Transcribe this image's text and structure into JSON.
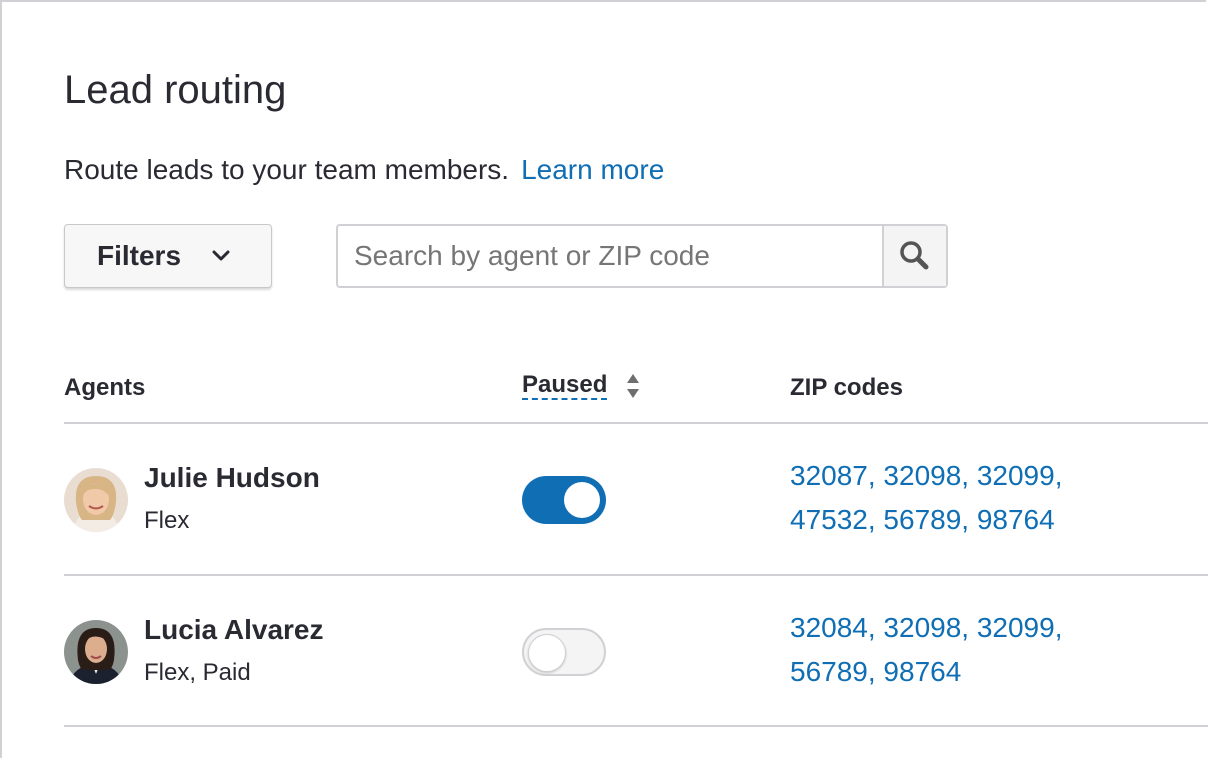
{
  "page": {
    "title": "Lead routing",
    "description": "Route leads to your team members.",
    "learn_more": "Learn more"
  },
  "toolbar": {
    "filters_label": "Filters",
    "search_placeholder": "Search by agent or ZIP code",
    "search_value": ""
  },
  "table": {
    "headers": {
      "agents": "Agents",
      "paused": "Paused",
      "zip_codes": "ZIP codes"
    },
    "rows": [
      {
        "name": "Julie Hudson",
        "type": "Flex",
        "paused": true,
        "zip_line_1": "32087, 32098, 32099,",
        "zip_line_2": "47532, 56789, 98764"
      },
      {
        "name": "Lucia Alvarez",
        "type": "Flex, Paid",
        "paused": false,
        "zip_line_1": "32084, 32098, 32099,",
        "zip_line_2": "56789, 98764"
      }
    ]
  },
  "icons": {
    "filters": "chevron-down-icon",
    "search": "search-icon",
    "sort": "sort-icon"
  },
  "colors": {
    "accent": "#0f6eb4",
    "text": "#2a2a33",
    "border": "#d1d1d5"
  }
}
